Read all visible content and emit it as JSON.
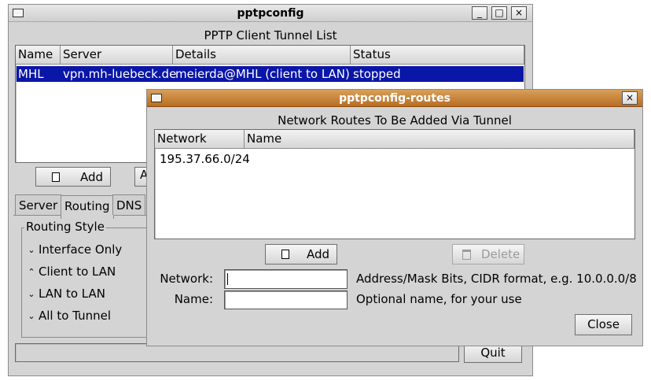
{
  "main_window": {
    "title": "pptpconfig",
    "list_title": "PPTP Client Tunnel List",
    "columns": [
      "Name",
      "Server",
      "Details",
      "Status"
    ],
    "rows": [
      {
        "name": "MHL",
        "server": "vpn.mh-luebeck.de",
        "details": "meierda@MHL (client to LAN)",
        "status": "stopped"
      }
    ],
    "add_label": "Add",
    "add_hidden_fragment": "A",
    "tabs": [
      "Server",
      "Routing",
      "DNS"
    ],
    "routing_style_label": "Routing Style",
    "routing_options": [
      {
        "label": "Interface Only",
        "selected": false
      },
      {
        "label": "Client to LAN",
        "selected": true
      },
      {
        "label": "LAN to LAN",
        "selected": false
      },
      {
        "label": "All to Tunnel",
        "selected": false
      }
    ],
    "quit_label": "Quit",
    "titlebar_buttons": {
      "minimize": "_",
      "maximize": "□",
      "close": "×"
    }
  },
  "routes_window": {
    "title": "pptpconfig-routes",
    "heading": "Network Routes To Be Added Via Tunnel",
    "columns": [
      "Network",
      "Name"
    ],
    "rows": [
      {
        "network": "195.37.66.0/24",
        "name": ""
      }
    ],
    "add_label": "Add",
    "delete_label": "Delete",
    "network_label": "Network:",
    "network_value": "",
    "network_hint": "Address/Mask Bits, CIDR format, e.g. 10.0.0.0/8",
    "name_label": "Name:",
    "name_value": "",
    "name_hint": "Optional name, for your use",
    "close_label": "Close",
    "close_glyph": "×"
  },
  "colors": {
    "selection": "#0a16a8",
    "routes_titlebar": "#c07a2e",
    "window_bg": "#d4d4d4"
  },
  "icons": {
    "add": "new-document-icon",
    "delete": "trash-icon",
    "window_menu": "window-menu-icon"
  }
}
